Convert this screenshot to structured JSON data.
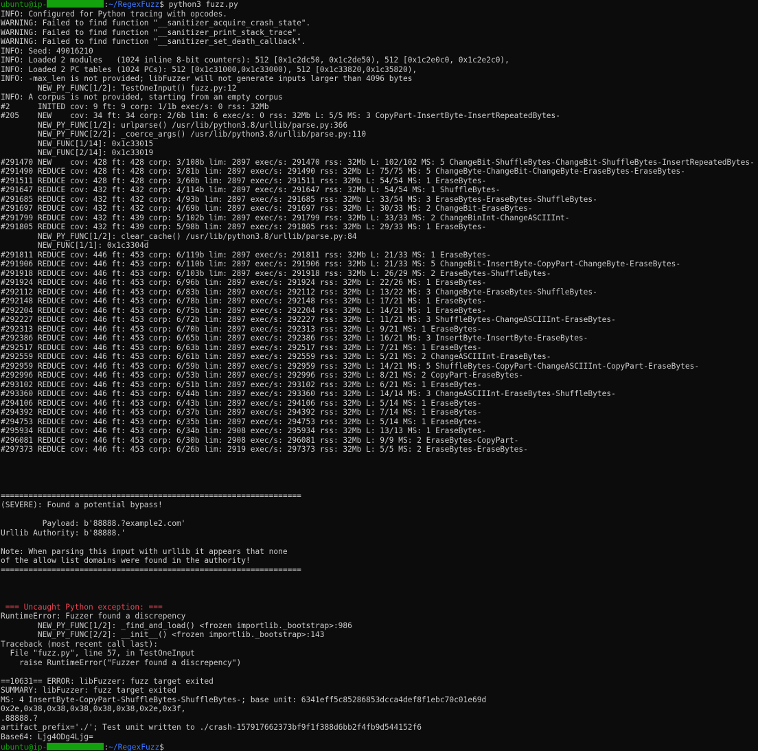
{
  "terminal": {
    "colors": {
      "background": "#0c0c0c",
      "text": "#cccccc",
      "user": "#13a10e",
      "path": "#3b78ff",
      "error": "#e74856"
    },
    "prompt": {
      "user": "ubuntu@ip-",
      "separator": ":",
      "path": "~/RegexFuzz",
      "suffix": "$ "
    },
    "command": "python3 fuzz.py",
    "lines": [
      {
        "row": 1,
        "text": "INFO: Configured for Python tracing with opcodes."
      },
      {
        "row": 2,
        "text": "WARNING: Failed to find function \"__sanitizer_acquire_crash_state\"."
      },
      {
        "row": 3,
        "text": "WARNING: Failed to find function \"__sanitizer_print_stack_trace\"."
      },
      {
        "row": 4,
        "text": "WARNING: Failed to find function \"__sanitizer_set_death_callback\"."
      },
      {
        "row": 5,
        "text": "INFO: Seed: 49016210"
      },
      {
        "row": 6,
        "text": "INFO: Loaded 2 modules   (1024 inline 8-bit counters): 512 [0x1c2dc50, 0x1c2de50), 512 [0x1c2e0c0, 0x1c2e2c0),"
      },
      {
        "row": 7,
        "text": "INFO: Loaded 2 PC tables (1024 PCs): 512 [0x1c31000,0x1c33000), 512 [0x1c33820,0x1c35820),"
      },
      {
        "row": 8,
        "text": "INFO: -max_len is not provided; libFuzzer will not generate inputs larger than 4096 bytes"
      },
      {
        "row": 9,
        "text": "        NEW_PY_FUNC[1/2]: TestOneInput() fuzz.py:12"
      },
      {
        "row": 10,
        "text": "INFO: A corpus is not provided, starting from an empty corpus"
      },
      {
        "row": 11,
        "text": "#2      INITED cov: 9 ft: 9 corp: 1/1b exec/s: 0 rss: 32Mb"
      },
      {
        "row": 12,
        "text": "#205    NEW    cov: 34 ft: 34 corp: 2/6b lim: 6 exec/s: 0 rss: 32Mb L: 5/5 MS: 3 CopyPart-InsertByte-InsertRepeatedBytes-"
      },
      {
        "row": 13,
        "text": "        NEW_PY_FUNC[1/2]: urlparse() /usr/lib/python3.8/urllib/parse.py:366"
      },
      {
        "row": 14,
        "text": "        NEW_PY_FUNC[2/2]: _coerce_args() /usr/lib/python3.8/urllib/parse.py:110"
      },
      {
        "row": 15,
        "text": "        NEW_FUNC[1/14]: 0x1c33015"
      },
      {
        "row": 16,
        "text": "        NEW_FUNC[2/14]: 0x1c33019"
      },
      {
        "row": 17,
        "text": "#291470 NEW    cov: 428 ft: 428 corp: 3/108b lim: 2897 exec/s: 291470 rss: 32Mb L: 102/102 MS: 5 ChangeBit-ShuffleBytes-ChangeBit-ShuffleBytes-InsertRepeatedBytes-"
      },
      {
        "row": 18,
        "text": "#291490 REDUCE cov: 428 ft: 428 corp: 3/81b lim: 2897 exec/s: 291490 rss: 32Mb L: 75/75 MS: 5 ChangeByte-ChangeBit-ChangeByte-EraseBytes-EraseBytes-"
      },
      {
        "row": 19,
        "text": "#291511 REDUCE cov: 428 ft: 428 corp: 3/60b lim: 2897 exec/s: 291511 rss: 32Mb L: 54/54 MS: 1 EraseBytes-"
      },
      {
        "row": 20,
        "text": "#291647 REDUCE cov: 432 ft: 432 corp: 4/114b lim: 2897 exec/s: 291647 rss: 32Mb L: 54/54 MS: 1 ShuffleBytes-"
      },
      {
        "row": 21,
        "text": "#291685 REDUCE cov: 432 ft: 432 corp: 4/93b lim: 2897 exec/s: 291685 rss: 32Mb L: 33/54 MS: 3 EraseBytes-EraseBytes-ShuffleBytes-"
      },
      {
        "row": 22,
        "text": "#291697 REDUCE cov: 432 ft: 432 corp: 4/69b lim: 2897 exec/s: 291697 rss: 32Mb L: 30/33 MS: 2 ChangeBit-EraseBytes-"
      },
      {
        "row": 23,
        "text": "#291799 REDUCE cov: 432 ft: 439 corp: 5/102b lim: 2897 exec/s: 291799 rss: 32Mb L: 33/33 MS: 2 ChangeBinInt-ChangeASCIIInt-"
      },
      {
        "row": 24,
        "text": "#291805 REDUCE cov: 432 ft: 439 corp: 5/98b lim: 2897 exec/s: 291805 rss: 32Mb L: 29/33 MS: 1 EraseBytes-"
      },
      {
        "row": 25,
        "text": "        NEW_PY_FUNC[1/2]: clear_cache() /usr/lib/python3.8/urllib/parse.py:84"
      },
      {
        "row": 26,
        "text": "        NEW_FUNC[1/1]: 0x1c3304d"
      },
      {
        "row": 27,
        "text": "#291811 REDUCE cov: 446 ft: 453 corp: 6/119b lim: 2897 exec/s: 291811 rss: 32Mb L: 21/33 MS: 1 EraseBytes-"
      },
      {
        "row": 28,
        "text": "#291906 REDUCE cov: 446 ft: 453 corp: 6/110b lim: 2897 exec/s: 291906 rss: 32Mb L: 21/33 MS: 5 ChangeBit-InsertByte-CopyPart-ChangeByte-EraseBytes-"
      },
      {
        "row": 29,
        "text": "#291918 REDUCE cov: 446 ft: 453 corp: 6/103b lim: 2897 exec/s: 291918 rss: 32Mb L: 26/29 MS: 2 EraseBytes-ShuffleBytes-"
      },
      {
        "row": 30,
        "text": "#291924 REDUCE cov: 446 ft: 453 corp: 6/96b lim: 2897 exec/s: 291924 rss: 32Mb L: 22/26 MS: 1 EraseBytes-"
      },
      {
        "row": 31,
        "text": "#292112 REDUCE cov: 446 ft: 453 corp: 6/83b lim: 2897 exec/s: 292112 rss: 32Mb L: 13/22 MS: 3 ChangeByte-EraseBytes-ShuffleBytes-"
      },
      {
        "row": 32,
        "text": "#292148 REDUCE cov: 446 ft: 453 corp: 6/78b lim: 2897 exec/s: 292148 rss: 32Mb L: 17/21 MS: 1 EraseBytes-"
      },
      {
        "row": 33,
        "text": "#292204 REDUCE cov: 446 ft: 453 corp: 6/75b lim: 2897 exec/s: 292204 rss: 32Mb L: 14/21 MS: 1 EraseBytes-"
      },
      {
        "row": 34,
        "text": "#292227 REDUCE cov: 446 ft: 453 corp: 6/72b lim: 2897 exec/s: 292227 rss: 32Mb L: 11/21 MS: 3 ShuffleBytes-ChangeASCIIInt-EraseBytes-"
      },
      {
        "row": 35,
        "text": "#292313 REDUCE cov: 446 ft: 453 corp: 6/70b lim: 2897 exec/s: 292313 rss: 32Mb L: 9/21 MS: 1 EraseBytes-"
      },
      {
        "row": 36,
        "text": "#292386 REDUCE cov: 446 ft: 453 corp: 6/65b lim: 2897 exec/s: 292386 rss: 32Mb L: 16/21 MS: 3 InsertByte-InsertByte-EraseBytes-"
      },
      {
        "row": 37,
        "text": "#292517 REDUCE cov: 446 ft: 453 corp: 6/63b lim: 2897 exec/s: 292517 rss: 32Mb L: 7/21 MS: 1 EraseBytes-"
      },
      {
        "row": 38,
        "text": "#292559 REDUCE cov: 446 ft: 453 corp: 6/61b lim: 2897 exec/s: 292559 rss: 32Mb L: 5/21 MS: 2 ChangeASCIIInt-EraseBytes-"
      },
      {
        "row": 39,
        "text": "#292959 REDUCE cov: 446 ft: 453 corp: 6/59b lim: 2897 exec/s: 292959 rss: 32Mb L: 14/21 MS: 5 ShuffleBytes-CopyPart-ChangeASCIIInt-CopyPart-EraseBytes-"
      },
      {
        "row": 40,
        "text": "#292996 REDUCE cov: 446 ft: 453 corp: 6/53b lim: 2897 exec/s: 292996 rss: 32Mb L: 8/21 MS: 2 CopyPart-EraseBytes-"
      },
      {
        "row": 41,
        "text": "#293102 REDUCE cov: 446 ft: 453 corp: 6/51b lim: 2897 exec/s: 293102 rss: 32Mb L: 6/21 MS: 1 EraseBytes-"
      },
      {
        "row": 42,
        "text": "#293360 REDUCE cov: 446 ft: 453 corp: 6/44b lim: 2897 exec/s: 293360 rss: 32Mb L: 14/14 MS: 3 ChangeASCIIInt-EraseBytes-ShuffleBytes-"
      },
      {
        "row": 43,
        "text": "#294106 REDUCE cov: 446 ft: 453 corp: 6/43b lim: 2897 exec/s: 294106 rss: 32Mb L: 5/14 MS: 1 EraseBytes-"
      },
      {
        "row": 44,
        "text": "#294392 REDUCE cov: 446 ft: 453 corp: 6/37b lim: 2897 exec/s: 294392 rss: 32Mb L: 7/14 MS: 1 EraseBytes-"
      },
      {
        "row": 45,
        "text": "#294753 REDUCE cov: 446 ft: 453 corp: 6/35b lim: 2897 exec/s: 294753 rss: 32Mb L: 5/14 MS: 1 EraseBytes-"
      },
      {
        "row": 46,
        "text": "#295934 REDUCE cov: 446 ft: 453 corp: 6/34b lim: 2908 exec/s: 295934 rss: 32Mb L: 13/13 MS: 1 EraseBytes-"
      },
      {
        "row": 47,
        "text": "#296081 REDUCE cov: 446 ft: 453 corp: 6/30b lim: 2908 exec/s: 296081 rss: 32Mb L: 9/9 MS: 2 EraseBytes-CopyPart-"
      },
      {
        "row": 48,
        "text": "#297373 REDUCE cov: 446 ft: 453 corp: 6/26b lim: 2919 exec/s: 297373 rss: 32Mb L: 5/5 MS: 2 EraseBytes-EraseBytes-"
      },
      {
        "row": 53,
        "text": "================================================================="
      },
      {
        "row": 54,
        "text": "(SEVERE): Found a potential bypass!"
      },
      {
        "row": 56,
        "text": "         Payload: b'88888.?example2.com'"
      },
      {
        "row": 57,
        "text": "Urllib Authority: b'88888.'"
      },
      {
        "row": 59,
        "text": "Note: When parsing this input with urllib it appears that none"
      },
      {
        "row": 60,
        "text": "of the allow list domains were found in the authority!"
      },
      {
        "row": 61,
        "text": "================================================================="
      },
      {
        "row": 65,
        "text": " === Uncaught Python exception: ===",
        "style": "red"
      },
      {
        "row": 66,
        "text": "RuntimeError: Fuzzer found a discrepency"
      },
      {
        "row": 67,
        "text": "        NEW_PY_FUNC[1/2]: _find_and_load() <frozen importlib._bootstrap>:986"
      },
      {
        "row": 68,
        "text": "        NEW_PY_FUNC[2/2]: __init__() <frozen importlib._bootstrap>:143"
      },
      {
        "row": 69,
        "text": "Traceback (most recent call last):"
      },
      {
        "row": 70,
        "text": "  File \"fuzz.py\", line 57, in TestOneInput"
      },
      {
        "row": 71,
        "text": "    raise RuntimeError(\"Fuzzer found a discrepency\")"
      },
      {
        "row": 73,
        "text": "==10631== ERROR: libFuzzer: fuzz target exited"
      },
      {
        "row": 74,
        "text": "SUMMARY: libFuzzer: fuzz target exited"
      },
      {
        "row": 75,
        "text": "MS: 4 InsertByte-CopyPart-ShuffleBytes-ShuffleBytes-; base unit: 6341eff5c85286853dcca4def8f1ebc70c01e69d"
      },
      {
        "row": 76,
        "text": "0x2e,0x38,0x38,0x38,0x38,0x38,0x2e,0x3f,"
      },
      {
        "row": 77,
        "text": ".88888.?"
      },
      {
        "row": 78,
        "text": "artifact_prefix='./'; Test unit written to ./crash-157917662373bf9f1f388d6bb2f4fb9d544152f6"
      },
      {
        "row": 79,
        "text": "Base64: Ljg4ODg4Ljg="
      }
    ]
  }
}
